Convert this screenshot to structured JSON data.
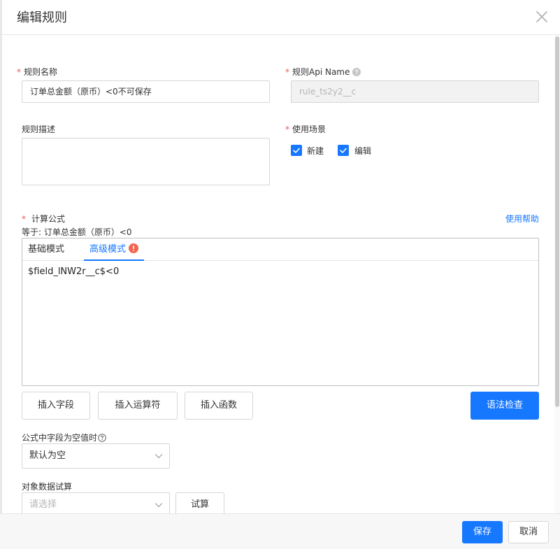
{
  "dialog": {
    "title": "编辑规则",
    "close_icon": "close-icon"
  },
  "form": {
    "rule_name": {
      "label": "规则名称",
      "required": "*",
      "value": "订单总金额（原币）<0不可保存"
    },
    "api_name": {
      "label": "规则Api Name",
      "required": "*",
      "value": "rule_ts2y2__c",
      "help_icon": "question-circle-icon"
    },
    "description": {
      "label": "规则描述",
      "value": ""
    },
    "scene": {
      "label": "使用场景",
      "required": "*",
      "options": [
        {
          "label": "新建",
          "checked": true
        },
        {
          "label": "编辑",
          "checked": true
        }
      ]
    },
    "formula": {
      "label": "计算公式",
      "required": "*",
      "help_link": "使用帮助",
      "equals_hint": "等于: 订单总金额（原币）<0",
      "tabs": [
        {
          "label": "基础模式",
          "active": false
        },
        {
          "label": "高级模式",
          "active": true,
          "icon": "warning-circle-icon"
        }
      ],
      "code": "$field_lNW2r__c$<0",
      "buttons": {
        "insert_field": "插入字段",
        "insert_operator": "插入运算符",
        "insert_function": "插入函数",
        "syntax_check": "语法检查"
      }
    },
    "null_field": {
      "label": "公式中字段为空值时",
      "help_icon": "question-circle-icon",
      "selected": "默认为空"
    },
    "trial": {
      "label": "对象数据试算",
      "placeholder": "请选择",
      "button": "试算"
    }
  },
  "footer": {
    "save": "保存",
    "cancel": "取消"
  },
  "colors": {
    "primary": "#1677ff",
    "required": "#e85a4f",
    "warning": "#f0674f"
  }
}
